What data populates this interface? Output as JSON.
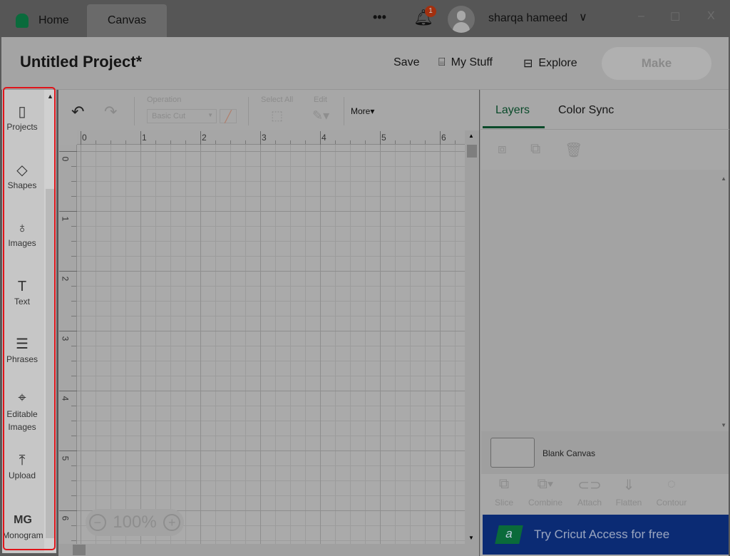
{
  "topbar": {
    "home": "Home",
    "canvas": "Canvas",
    "more": "•••",
    "notifications": "1",
    "user": "sharqa hameed",
    "minimize": "–",
    "maximize": "☐",
    "close": "X"
  },
  "header": {
    "title": "Untitled Project*",
    "save": "Save",
    "my_stuff": "My Stuff",
    "explore": "Explore",
    "make": "Make"
  },
  "sidebar": [
    {
      "label": "Projects",
      "icon": "▯"
    },
    {
      "label": "Shapes",
      "icon": "◇"
    },
    {
      "label": "Images",
      "icon": "♁"
    },
    {
      "label": "Text",
      "icon": "T"
    },
    {
      "label": "Phrases",
      "icon": "☰"
    },
    {
      "label": "Editable Images",
      "icon": "⌖"
    },
    {
      "label": "Upload",
      "icon": "⤒"
    },
    {
      "label": "Monogram",
      "icon": "MG"
    }
  ],
  "toolbar": {
    "operation_label": "Operation",
    "operation_value": "Basic Cut",
    "select_all": "Select All",
    "edit": "Edit",
    "more": "More"
  },
  "ruler": {
    "top": [
      "0",
      "1",
      "2",
      "3",
      "4",
      "5",
      "6"
    ],
    "left": [
      "0",
      "1",
      "2",
      "3",
      "4",
      "5",
      "6"
    ]
  },
  "zoom": {
    "value": "100%",
    "minus": "−",
    "plus": "+"
  },
  "panel": {
    "tab_layers": "Layers",
    "tab_color_sync": "Color Sync",
    "blank_canvas": "Blank Canvas",
    "tools": [
      {
        "label": "Slice",
        "icon": "⧉"
      },
      {
        "label": "Combine",
        "icon": "⧉▾"
      },
      {
        "label": "Attach",
        "icon": "⊂⊃"
      },
      {
        "label": "Flatten",
        "icon": "⇓"
      },
      {
        "label": "Contour",
        "icon": "◌"
      }
    ],
    "banner": "Try Cricut Access for free",
    "banner_logo": "a"
  }
}
